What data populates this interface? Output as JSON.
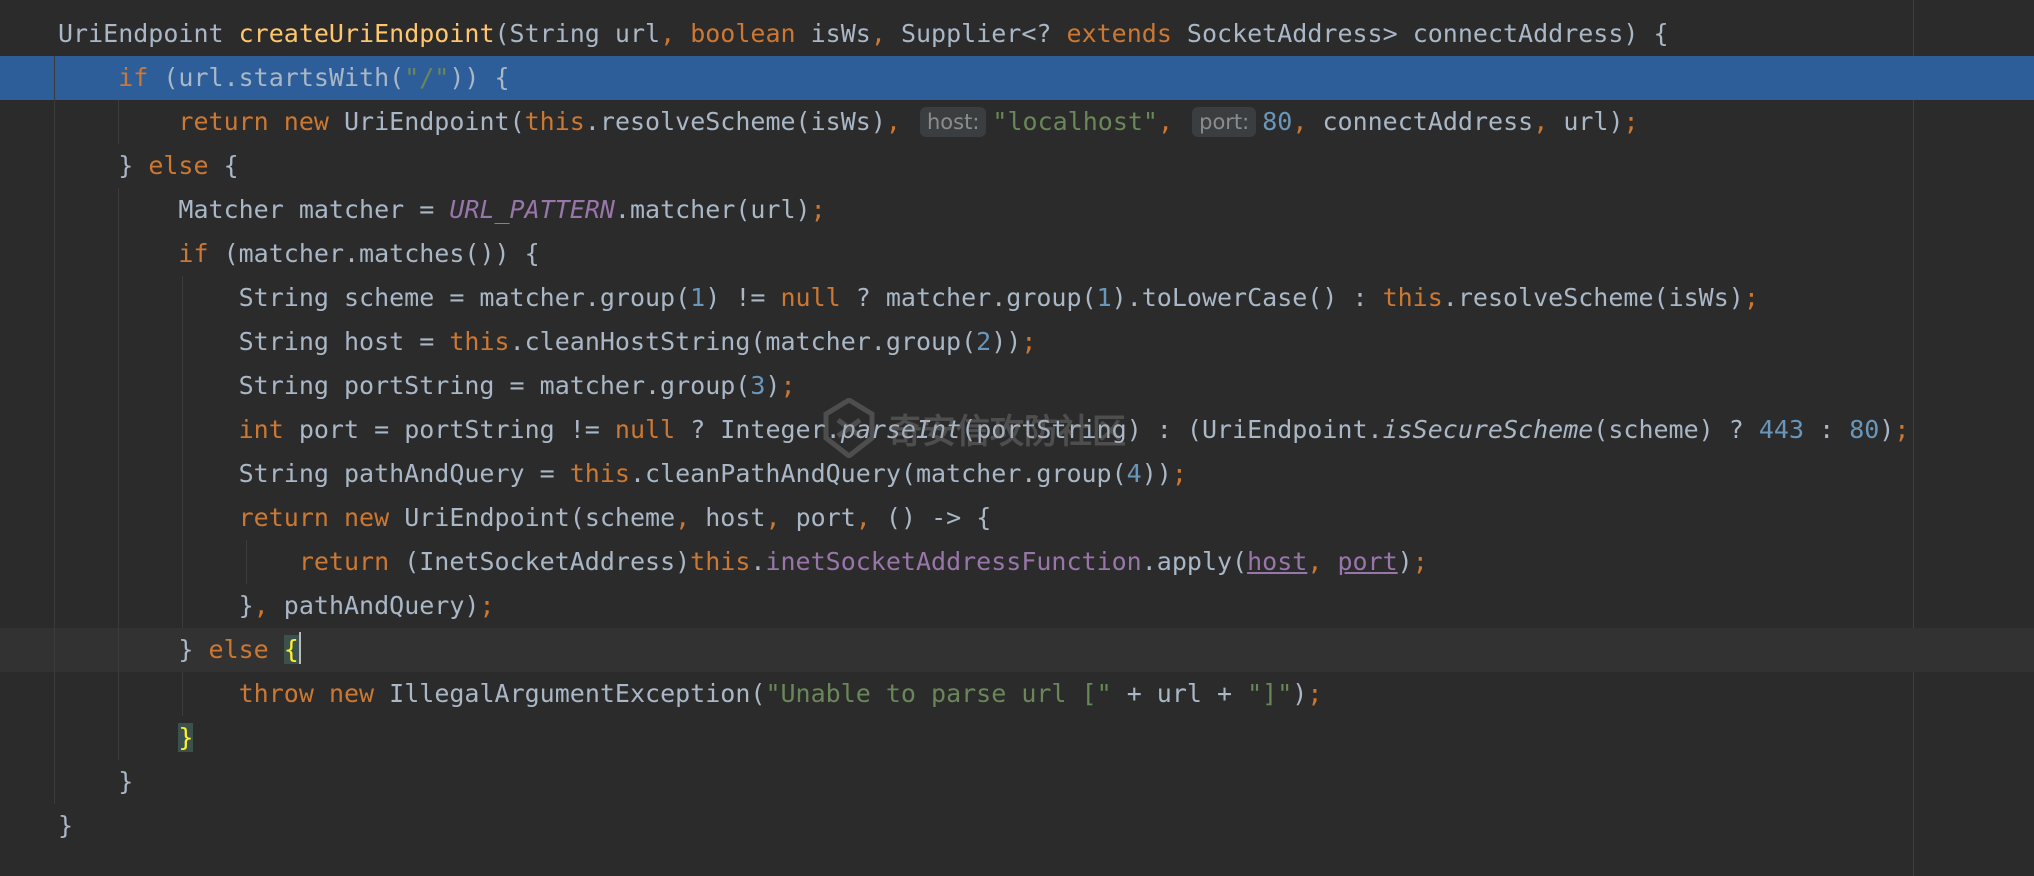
{
  "lines": [
    "UriEndpoint createUriEndpoint(String url, boolean isWs, Supplier<? extends SocketAddress> connectAddress) {",
    "    if (url.startsWith(\"/\")) {",
    "        return new UriEndpoint(this.resolveScheme(isWs), host: \"localhost\", port: 80, connectAddress, url);",
    "    } else {",
    "        Matcher matcher = URL_PATTERN.matcher(url);",
    "        if (matcher.matches()) {",
    "            String scheme = matcher.group(1) != null ? matcher.group(1).toLowerCase() : this.resolveScheme(isWs);",
    "            String host = this.cleanHostString(matcher.group(2));",
    "            String portString = matcher.group(3);",
    "            int port = portString != null ? Integer.parseInt(portString) : (UriEndpoint.isSecureScheme(scheme) ? 443 : 80);",
    "            String pathAndQuery = this.cleanPathAndQuery(matcher.group(4));",
    "            return new UriEndpoint(scheme, host, port, () -> {",
    "                return (InetSocketAddress)this.inetSocketAddressFunction.apply(host, port);",
    "            }, pathAndQuery);",
    "        } else {",
    "            throw new IllegalArgumentException(\"Unable to parse url [\" + url + \"]\");",
    "        }",
    "    }",
    "}"
  ],
  "inlay_hints": {
    "host": "host:",
    "port": "port:"
  },
  "highlighted_line": 2,
  "caret_line": 15,
  "gutter_icons": [
    {
      "line": 15,
      "icon": "lightbulb-icon",
      "color": "#e8b93b"
    }
  ],
  "watermark": "奇安信攻防社区",
  "colors": {
    "background": "#2b2b2b",
    "selection": "#2d5e9a",
    "current_line": "#323232",
    "keyword": "#cc7832",
    "method_declaration": "#ffc66d",
    "string": "#6a8759",
    "number": "#6897bb",
    "field": "#9876aa",
    "default_text": "#a9b7c6"
  }
}
